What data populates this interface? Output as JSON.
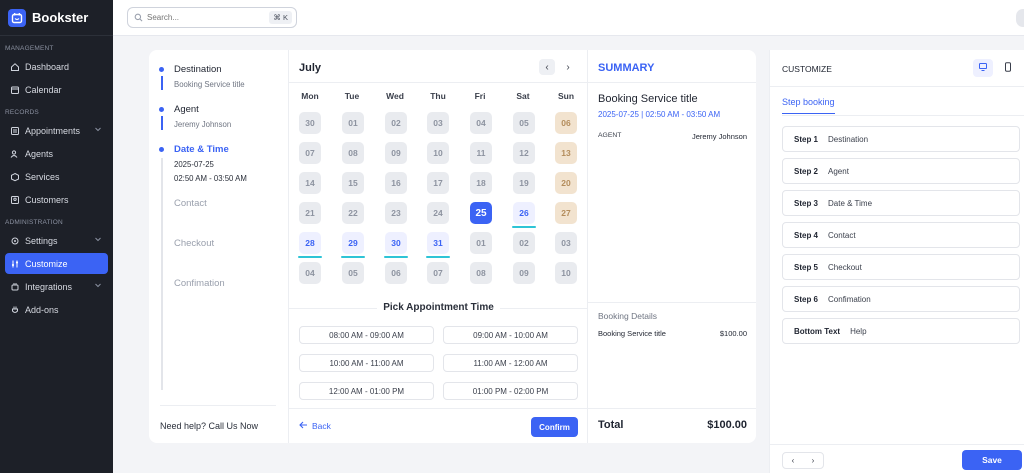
{
  "app": {
    "name": "Bookster"
  },
  "search": {
    "placeholder": "Search...",
    "shortcut": "⌘ K"
  },
  "sidebar": {
    "sections": {
      "management": "MANAGEMENT",
      "records": "RECORDS",
      "administration": "ADMINISTRATION"
    },
    "items": {
      "dashboard": "Dashboard",
      "calendar": "Calendar",
      "appointments": "Appointments",
      "agents": "Agents",
      "services": "Services",
      "customers": "Customers",
      "settings": "Settings",
      "customize": "Customize",
      "integrations": "Integrations",
      "addons": "Add-ons"
    },
    "active": "customize"
  },
  "steps": [
    {
      "title": "Destination",
      "sub": "Booking Service title",
      "state": "done"
    },
    {
      "title": "Agent",
      "sub": "Jeremy Johnson",
      "state": "done"
    },
    {
      "title": "Date & Time",
      "sub": "2025-07-25",
      "sub2": "02:50 AM - 03:50 AM",
      "state": "active"
    },
    {
      "title": "Contact",
      "state": "inactive"
    },
    {
      "title": "Checkout",
      "state": "inactive"
    },
    {
      "title": "Confimation",
      "state": "inactive"
    }
  ],
  "help": "Need help? Call Us Now",
  "calendar": {
    "month": "July",
    "dow": [
      "Mon",
      "Tue",
      "Wed",
      "Thu",
      "Fri",
      "Sat",
      "Sun"
    ],
    "weeks": [
      [
        {
          "d": "30"
        },
        {
          "d": "01"
        },
        {
          "d": "02"
        },
        {
          "d": "03"
        },
        {
          "d": "04"
        },
        {
          "d": "05"
        },
        {
          "d": "06",
          "t": "weekend"
        }
      ],
      [
        {
          "d": "07"
        },
        {
          "d": "08"
        },
        {
          "d": "09"
        },
        {
          "d": "10"
        },
        {
          "d": "11"
        },
        {
          "d": "12"
        },
        {
          "d": "13",
          "t": "weekend"
        }
      ],
      [
        {
          "d": "14"
        },
        {
          "d": "15"
        },
        {
          "d": "16"
        },
        {
          "d": "17"
        },
        {
          "d": "18"
        },
        {
          "d": "19"
        },
        {
          "d": "20",
          "t": "weekend"
        }
      ],
      [
        {
          "d": "21"
        },
        {
          "d": "22"
        },
        {
          "d": "23"
        },
        {
          "d": "24"
        },
        {
          "d": "25",
          "t": "selected"
        },
        {
          "d": "26",
          "t": "avail"
        },
        {
          "d": "27",
          "t": "weekend"
        }
      ],
      [
        {
          "d": "28",
          "t": "avail"
        },
        {
          "d": "29",
          "t": "avail"
        },
        {
          "d": "30",
          "t": "avail"
        },
        {
          "d": "31",
          "t": "avail"
        },
        {
          "d": "01"
        },
        {
          "d": "02"
        },
        {
          "d": "03"
        }
      ],
      [
        {
          "d": "04"
        },
        {
          "d": "05"
        },
        {
          "d": "06"
        },
        {
          "d": "07"
        },
        {
          "d": "08"
        },
        {
          "d": "09"
        },
        {
          "d": "10"
        }
      ]
    ],
    "pick_title": "Pick Appointment Time",
    "slots": [
      "08:00 AM - 09:00 AM",
      "09:00 AM - 10:00 AM",
      "10:00 AM - 11:00 AM",
      "11:00 AM - 12:00 AM",
      "12:00 AM - 01:00 PM",
      "01:00 PM - 02:00 PM"
    ],
    "back": "Back",
    "confirm": "Confirm"
  },
  "summary": {
    "title": "SUMMARY",
    "service": "Booking Service title",
    "time": "2025-07-25 | 02:50 AM - 03:50 AM",
    "agent_label": "AGENT",
    "agent_value": "Jeremy Johnson",
    "details_label": "Booking Details",
    "item": "Booking Service title",
    "item_price": "$100.00",
    "total_label": "Total",
    "total_value": "$100.00"
  },
  "customize": {
    "title": "CUSTOMIZE",
    "tab": "Step booking",
    "rows": [
      {
        "k": "Step 1",
        "v": "Destination"
      },
      {
        "k": "Step 2",
        "v": "Agent"
      },
      {
        "k": "Step 3",
        "v": "Date & Time"
      },
      {
        "k": "Step 4",
        "v": "Contact"
      },
      {
        "k": "Step 5",
        "v": "Checkout"
      },
      {
        "k": "Step 6",
        "v": "Confimation"
      },
      {
        "k": "Bottom Text",
        "v": "Help"
      }
    ],
    "save": "Save"
  },
  "colors": {
    "accent": "#3b63f4",
    "sidebar": "#1d2028",
    "available_underline": "#2ec4d6",
    "weekend": "#f2e3cf"
  }
}
